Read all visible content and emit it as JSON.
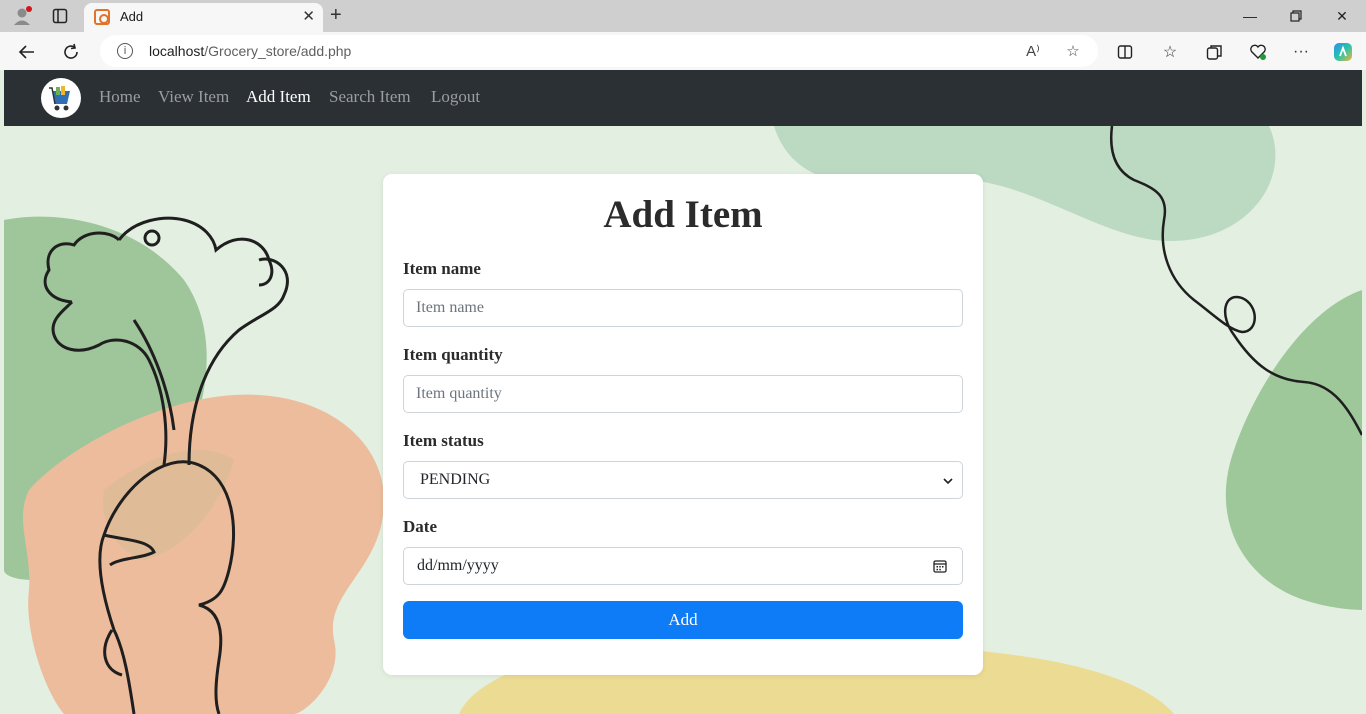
{
  "browser": {
    "tab_title": "Add",
    "url_host": "localhost",
    "url_path": "/Grocery_store/add.php",
    "read_aloud_label": "A⁾"
  },
  "navbar": {
    "links": [
      {
        "label": "Home"
      },
      {
        "label": "View Item"
      },
      {
        "label": "Add Item",
        "active": true
      },
      {
        "label": "Search Item"
      },
      {
        "label": "Logout"
      }
    ]
  },
  "form": {
    "title": "Add Item",
    "item_name": {
      "label": "Item name",
      "placeholder": "Item name",
      "value": ""
    },
    "item_quantity": {
      "label": "Item quantity",
      "placeholder": "Item quantity",
      "value": ""
    },
    "item_status": {
      "label": "Item status",
      "selected": "PENDING"
    },
    "date": {
      "label": "Date",
      "value": "dd/mm/yyyy"
    },
    "submit_label": "Add"
  },
  "colors": {
    "navbar_bg": "#2b3035",
    "page_bg": "#e3efe0",
    "primary_button": "#0d7cf6",
    "blob_green": "#9ec79a",
    "blob_peach": "#ecbc9c",
    "blob_yellow": "#ecdb93"
  }
}
